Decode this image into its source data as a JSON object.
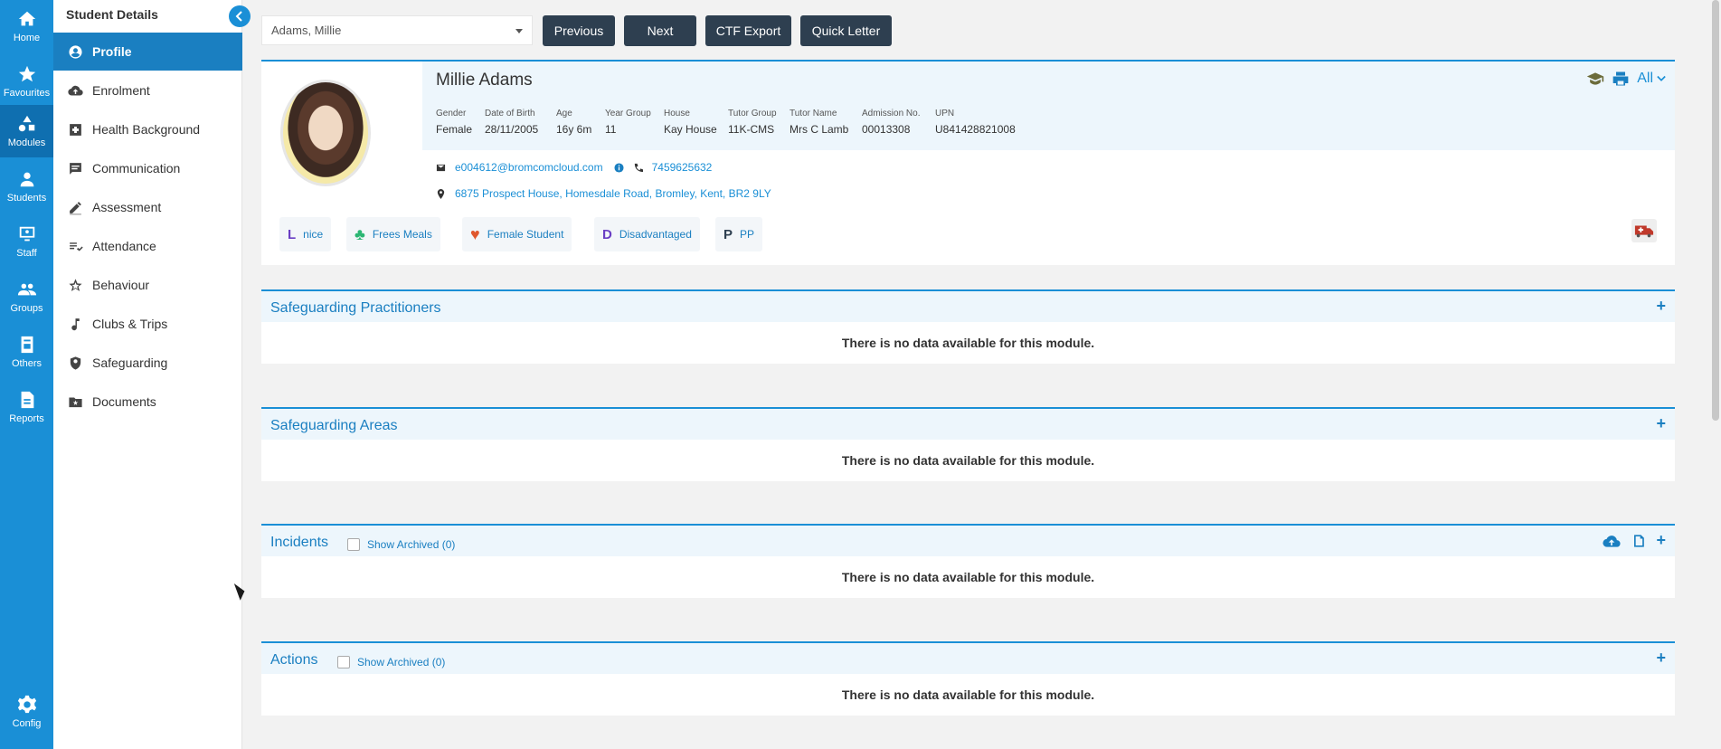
{
  "rail": {
    "items": [
      {
        "label": "Home",
        "icon": "home-icon"
      },
      {
        "label": "Favourites",
        "icon": "star-icon"
      },
      {
        "label": "Modules",
        "icon": "shapes-icon"
      },
      {
        "label": "Students",
        "icon": "person-icon"
      },
      {
        "label": "Staff",
        "icon": "presentation-icon"
      },
      {
        "label": "Groups",
        "icon": "group-icon"
      },
      {
        "label": "Others",
        "icon": "badge-icon"
      },
      {
        "label": "Reports",
        "icon": "document-icon"
      }
    ],
    "config_label": "Config"
  },
  "sidebar": {
    "title": "Student Details",
    "items": [
      {
        "label": "Profile",
        "icon": "user-circle-icon"
      },
      {
        "label": "Enrolment",
        "icon": "cloud-upload-icon"
      },
      {
        "label": "Health Background",
        "icon": "medical-plus-icon"
      },
      {
        "label": "Communication",
        "icon": "chat-icon"
      },
      {
        "label": "Assessment",
        "icon": "pencil-icon"
      },
      {
        "label": "Attendance",
        "icon": "checklist-icon"
      },
      {
        "label": "Behaviour",
        "icon": "star-outline-icon"
      },
      {
        "label": "Clubs & Trips",
        "icon": "music-note-icon"
      },
      {
        "label": "Safeguarding",
        "icon": "shield-icon"
      },
      {
        "label": "Documents",
        "icon": "folder-star-icon"
      }
    ]
  },
  "toolbar": {
    "student_select": "Adams, Millie",
    "previous": "Previous",
    "next": "Next",
    "ctf_export": "CTF Export",
    "quick_letter": "Quick Letter"
  },
  "profile": {
    "name": "Millie Adams",
    "fields": [
      {
        "label": "Gender",
        "value": "Female"
      },
      {
        "label": "Date of Birth",
        "value": "28/11/2005"
      },
      {
        "label": "Age",
        "value": "16y 6m"
      },
      {
        "label": "Year Group",
        "value": "11"
      },
      {
        "label": "House",
        "value": "Kay House"
      },
      {
        "label": "Tutor Group",
        "value": "11K-CMS"
      },
      {
        "label": "Tutor Name",
        "value": "Mrs C Lamb"
      },
      {
        "label": "Admission No.",
        "value": "00013308"
      },
      {
        "label": "UPN",
        "value": "U841428821008"
      }
    ],
    "email": "e004612@bromcomcloud.com",
    "phone": "7459625632",
    "address": "6875 Prospect House, Homesdale Road, Bromley, Kent, BR2 9LY",
    "all_label": "All",
    "tags": [
      {
        "glyph": "L",
        "label": "nice",
        "color": "#6a3fc4"
      },
      {
        "glyph": "♣",
        "label": "Frees Meals",
        "color": "#2bb673"
      },
      {
        "glyph": "♥",
        "label": "Female Student",
        "color": "#e0572d"
      },
      {
        "glyph": "D",
        "label": "Disadvantaged",
        "color": "#6a3fc4"
      },
      {
        "glyph": "P",
        "label": "PP",
        "color": "#2e3f50"
      }
    ]
  },
  "modules": [
    {
      "title": "Safeguarding Practitioners",
      "empty": "There is no data available for this module."
    },
    {
      "title": "Safeguarding Areas",
      "empty": "There is no data available for this module."
    },
    {
      "title": "Incidents",
      "archived": "Show Archived (0)",
      "empty": "There is no data available for this module."
    },
    {
      "title": "Actions",
      "archived": "Show Archived (0)",
      "empty": "There is no data available for this module."
    }
  ],
  "colors": {
    "accent": "#1a8fd6",
    "dark_button": "#2e3f50",
    "panel_tint": "#edf6fc"
  }
}
